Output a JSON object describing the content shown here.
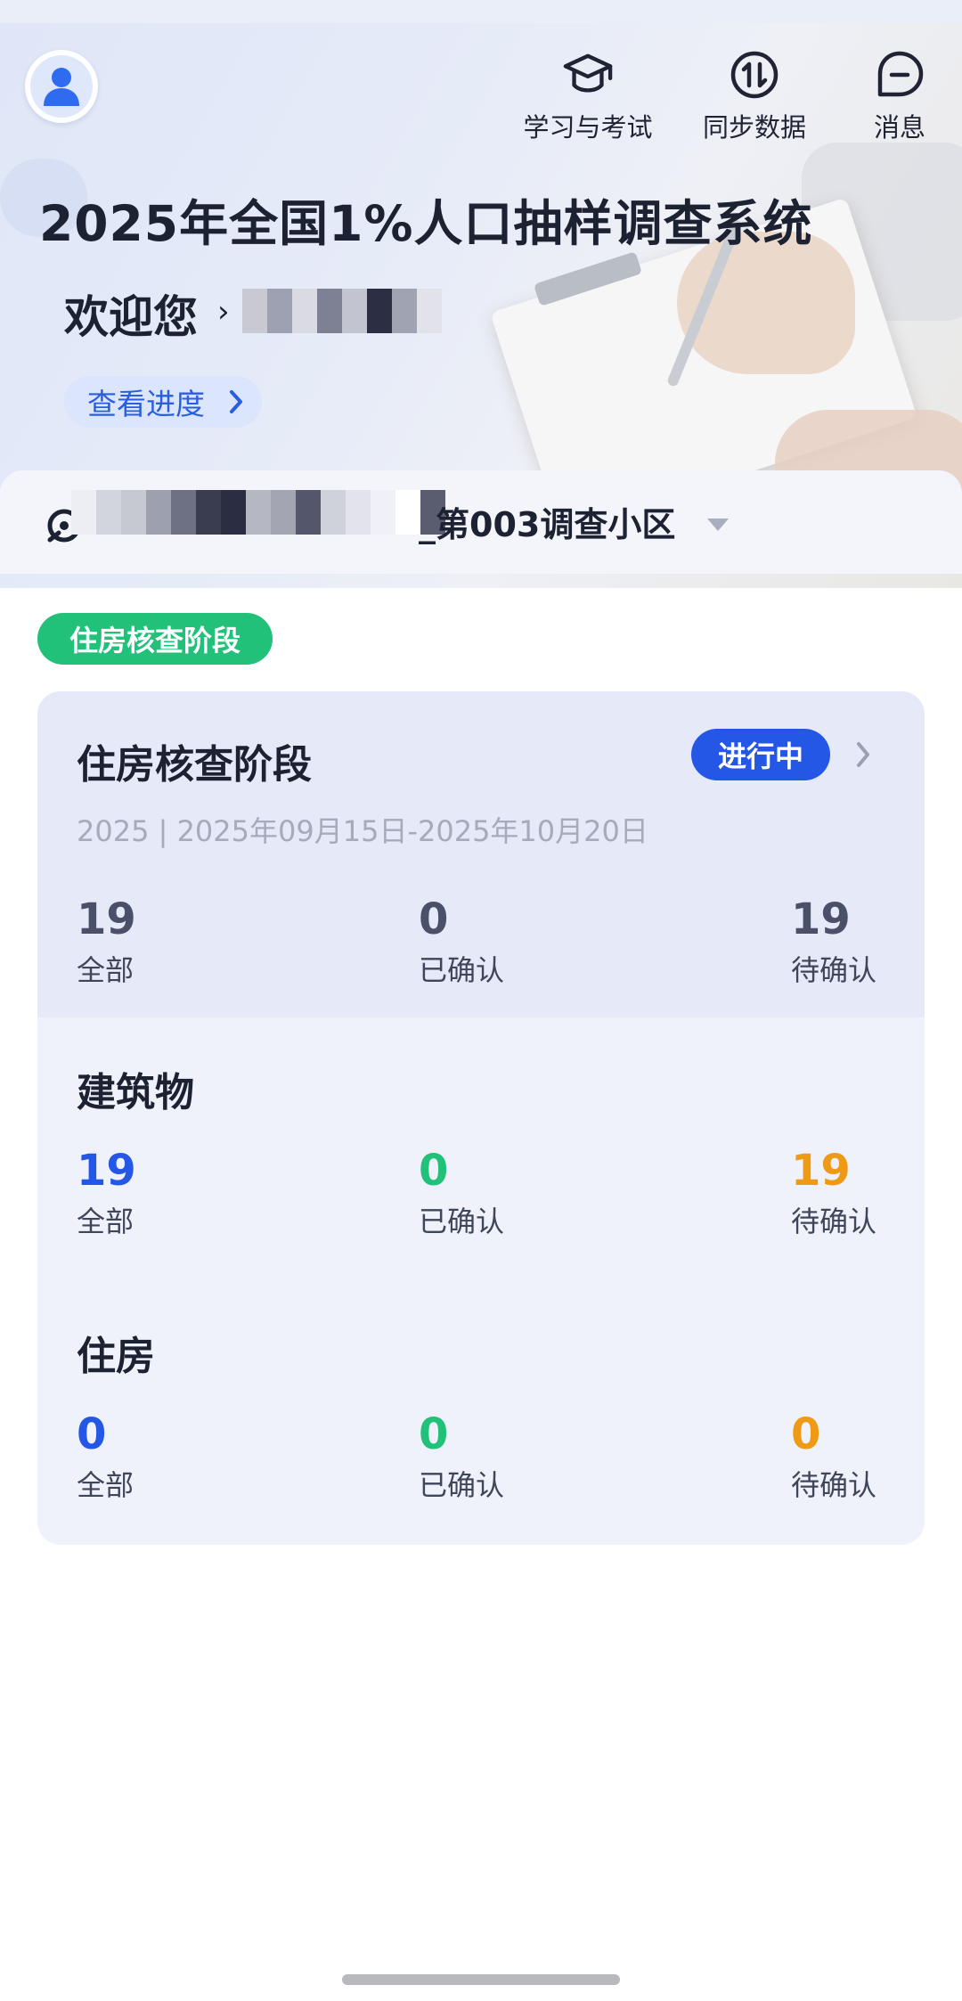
{
  "header": {
    "app_title": "2025年全国1%人口抽样调查系统",
    "welcome": "欢迎您",
    "progress_button": "查看进度",
    "actions": [
      {
        "label": "学习与考试",
        "icon": "graduation-cap-icon"
      },
      {
        "label": "同步数据",
        "icon": "sync-icon"
      },
      {
        "label": "消息",
        "icon": "message-icon"
      }
    ]
  },
  "location": {
    "area_label": "_第003调查小区",
    "icon": "location-pin-icon"
  },
  "stage_tag": "住房核查阶段",
  "card": {
    "title": "住房核查阶段",
    "status": "进行中",
    "period": "2025 | 2025年09月15日-2025年10月20日",
    "overall": {
      "total": {
        "value": "19",
        "label": "全部"
      },
      "confirmed": {
        "value": "0",
        "label": "已确认"
      },
      "pending": {
        "value": "19",
        "label": "待确认"
      }
    },
    "buildings": {
      "title": "建筑物",
      "total": {
        "value": "19",
        "label": "全部"
      },
      "confirmed": {
        "value": "0",
        "label": "已确认"
      },
      "pending": {
        "value": "19",
        "label": "待确认"
      }
    },
    "housing": {
      "title": "住房",
      "total": {
        "value": "0",
        "label": "全部"
      },
      "confirmed": {
        "value": "0",
        "label": "已确认"
      },
      "pending": {
        "value": "0",
        "label": "待确认"
      }
    }
  },
  "colors": {
    "accent_blue": "#2457e6",
    "green": "#22c17a",
    "orange": "#ee9a15",
    "dark": "#4a5068"
  }
}
